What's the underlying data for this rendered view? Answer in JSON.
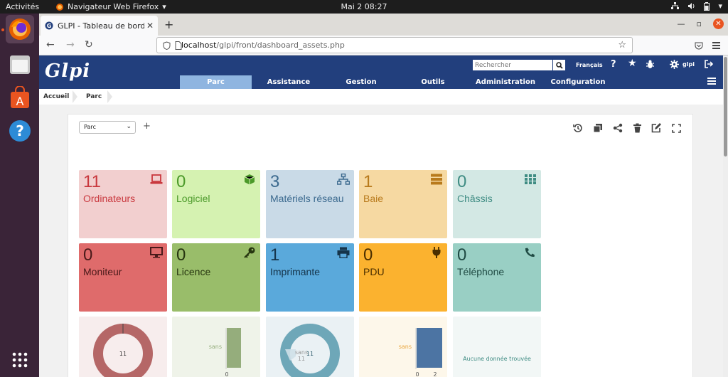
{
  "topbar": {
    "activities": "Activités",
    "app_name": "Navigateur Web Firefox",
    "clock": "Mai 2  08:27"
  },
  "browser": {
    "tab_title": "GLPI - Tableau de bord d",
    "url_host": "localhost",
    "url_path": "/glpi/front/dashboard_assets.php"
  },
  "glpi": {
    "logo": "Glpi",
    "search_placeholder": "Rechercher",
    "language": "Français",
    "user": "glpi",
    "menu": [
      {
        "label": "Parc",
        "active": true
      },
      {
        "label": "Assistance"
      },
      {
        "label": "Gestion"
      },
      {
        "label": "Outils"
      },
      {
        "label": "Administration"
      },
      {
        "label": "Configuration"
      }
    ],
    "breadcrumb": [
      "Accueil",
      "Parc"
    ]
  },
  "dashboard": {
    "selected": "Parc",
    "cards": [
      {
        "count": "11",
        "label": "Ordinateurs",
        "icon": "laptop-icon",
        "bg": "#f2cfcf",
        "fg": "#c9383e"
      },
      {
        "count": "0",
        "label": "Logiciel",
        "icon": "cube-icon",
        "bg": "#d5f2b1",
        "fg": "#4c9a2a"
      },
      {
        "count": "3",
        "label": "Matériels réseau",
        "icon": "network-icon",
        "bg": "#c9dae7",
        "fg": "#3c6a8f"
      },
      {
        "count": "1",
        "label": "Baie",
        "icon": "server-icon",
        "bg": "#f6d9a2",
        "fg": "#b87a1c"
      },
      {
        "count": "0",
        "label": "Châssis",
        "icon": "grid-icon",
        "bg": "#d3e8e4",
        "fg": "#3f8c83"
      },
      {
        "count": "0",
        "label": "Moniteur",
        "icon": "monitor-icon",
        "bg": "#df6b6b",
        "fg": "#4a1a1a"
      },
      {
        "count": "0",
        "label": "Licence",
        "icon": "key-icon",
        "bg": "#99bd6a",
        "fg": "#26350f"
      },
      {
        "count": "1",
        "label": "Imprimante",
        "icon": "printer-icon",
        "bg": "#5aa9db",
        "fg": "#15344a"
      },
      {
        "count": "0",
        "label": "PDU",
        "icon": "plug-icon",
        "bg": "#fbb22f",
        "fg": "#4a2e00"
      },
      {
        "count": "0",
        "label": "Téléphone",
        "icon": "phone-icon",
        "bg": "#99cfc4",
        "fg": "#1f4a43"
      }
    ],
    "charts": [
      {
        "type": "donut",
        "bg": "#f7eded",
        "color": "#b56767",
        "center": "11"
      },
      {
        "type": "bar",
        "bg": "#eff3e9",
        "color": "#95ad7c",
        "label": "sans",
        "tick": "0",
        "value": 1
      },
      {
        "type": "donut",
        "bg": "#eaf1f4",
        "color": "#6ea7b8",
        "center": "11",
        "slice_label": "sans",
        "slice_value": "11"
      },
      {
        "type": "bar",
        "bg": "#fdf7ea",
        "color": "#4c74a3",
        "label": "sans",
        "ticks": [
          "0",
          "2"
        ],
        "value": 2
      },
      {
        "type": "empty",
        "bg": "#f2f7f6",
        "message": "Aucune donnée trouvée"
      }
    ]
  }
}
